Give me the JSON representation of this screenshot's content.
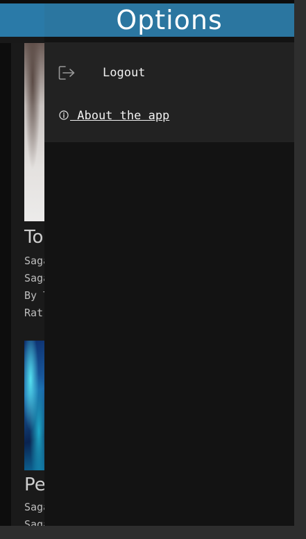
{
  "drawer": {
    "title": "Options",
    "menu": {
      "logout": {
        "label": "Logout",
        "icon": "logout-icon"
      },
      "about": {
        "label": " About the app",
        "icon": "info-icon"
      }
    }
  },
  "background_list": {
    "cards": [
      {
        "title_fragment": "To",
        "lines": [
          "Saga",
          "Saga",
          "By T",
          "Rat"
        ]
      },
      {
        "title_fragment": "Pe",
        "lines": [
          "Saga",
          "Saga"
        ]
      }
    ]
  },
  "colors": {
    "header_blue": "#2b76a0",
    "drawer_bg": "#131313",
    "menu_bg": "#222222",
    "text": "#f2f2f2"
  }
}
